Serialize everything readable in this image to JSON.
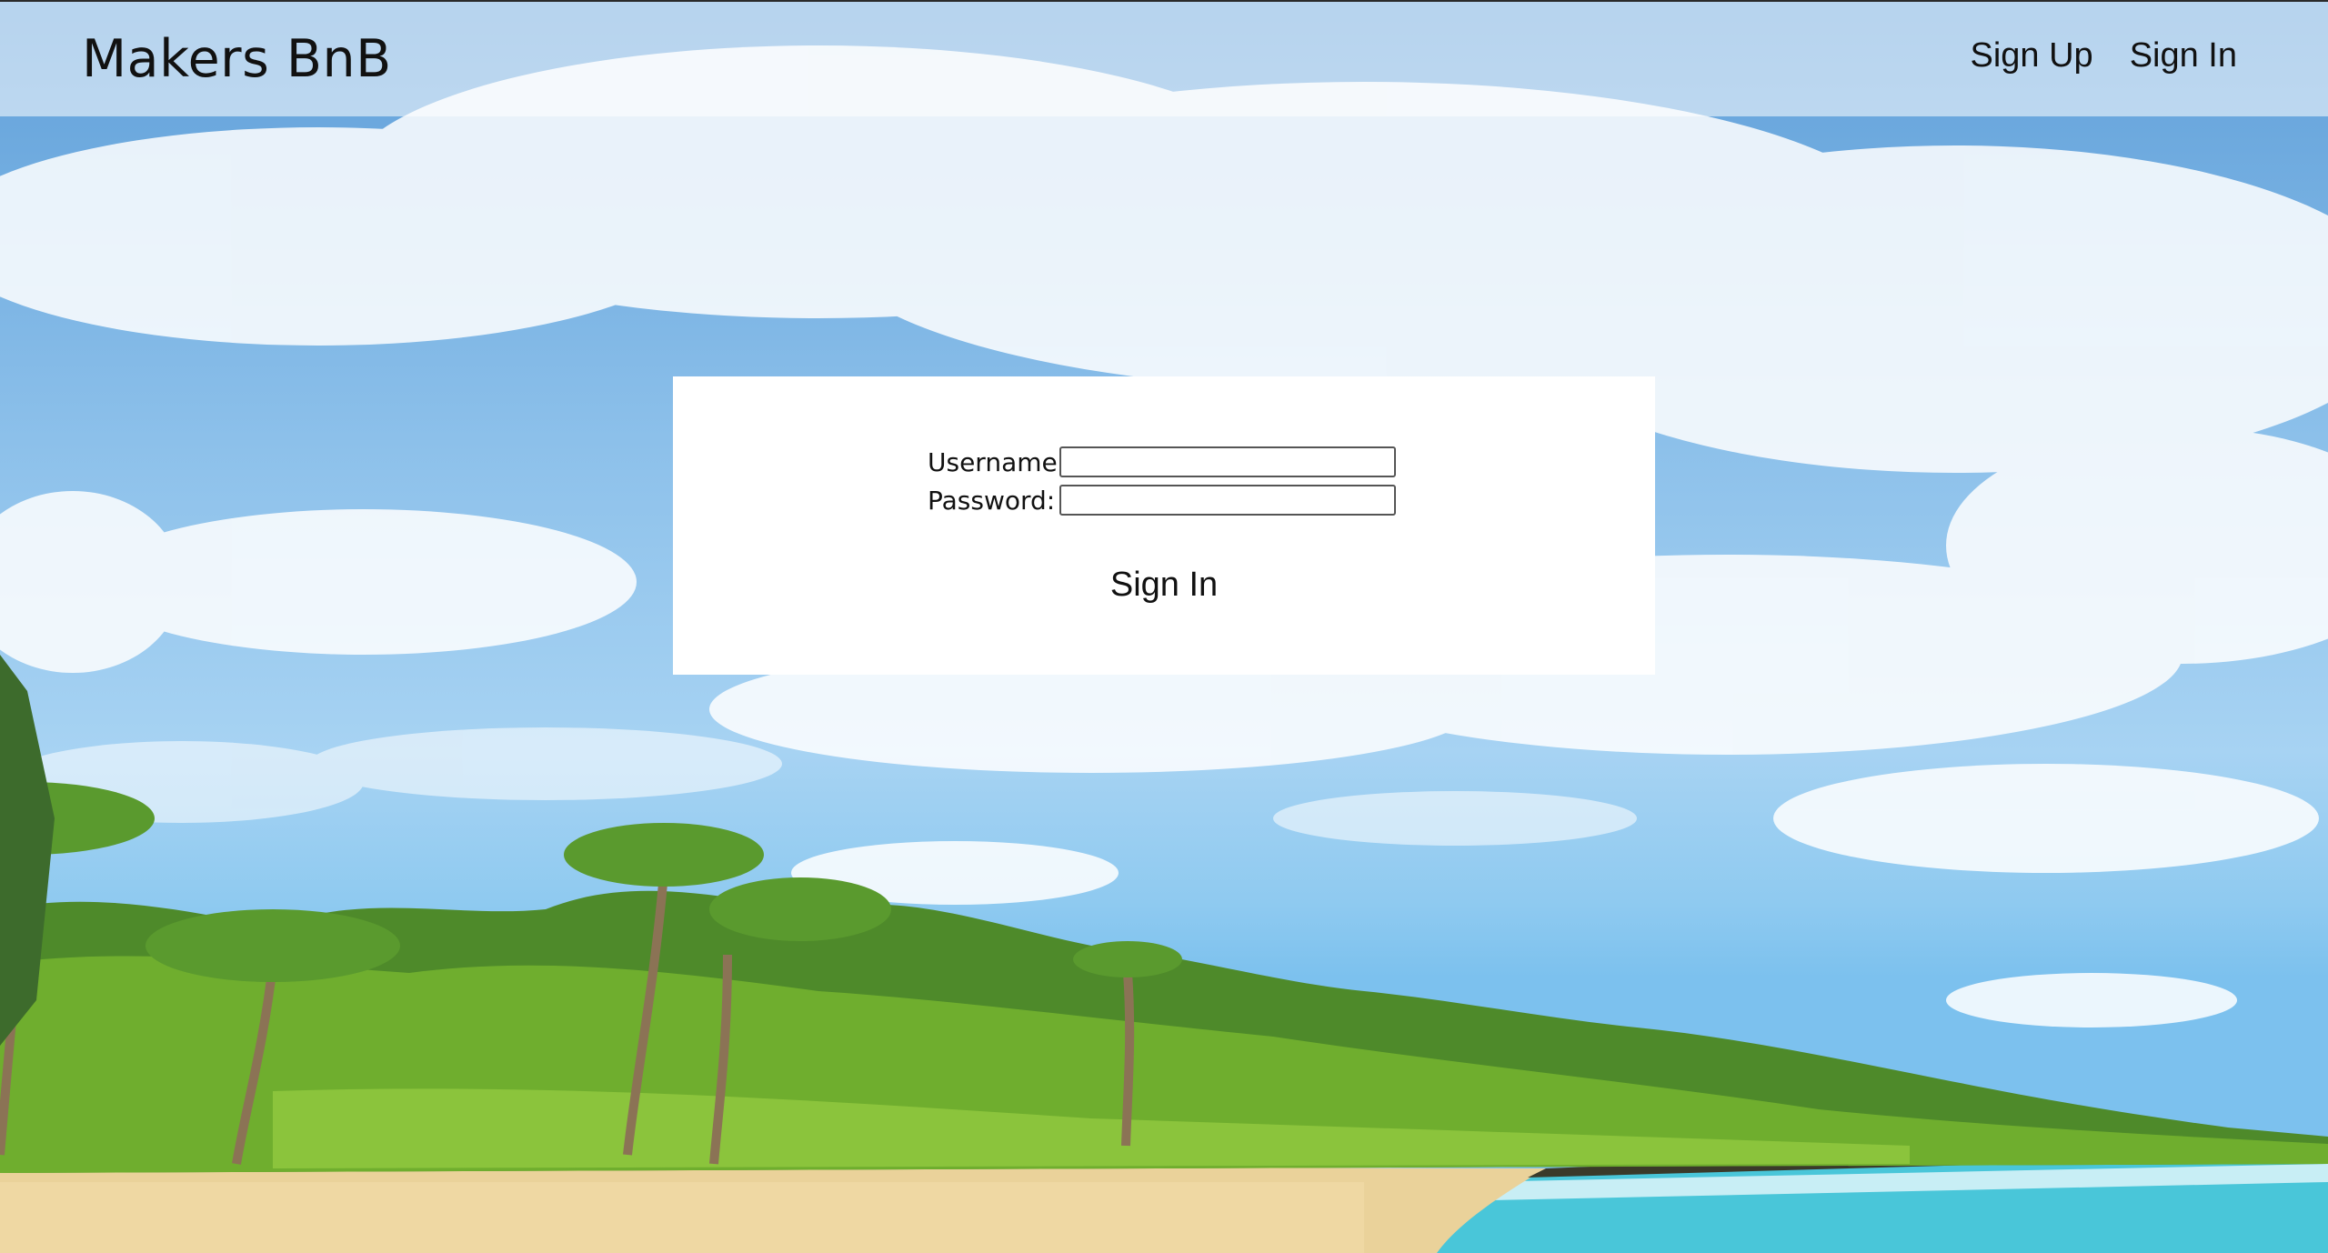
{
  "navbar": {
    "brand": "Makers BnB",
    "links": [
      {
        "label": "Sign Up"
      },
      {
        "label": "Sign In"
      }
    ]
  },
  "signin_form": {
    "username_label": "Username:",
    "username_value": "",
    "password_label": "Password:",
    "password_value": "",
    "submit_label": "Sign In"
  }
}
